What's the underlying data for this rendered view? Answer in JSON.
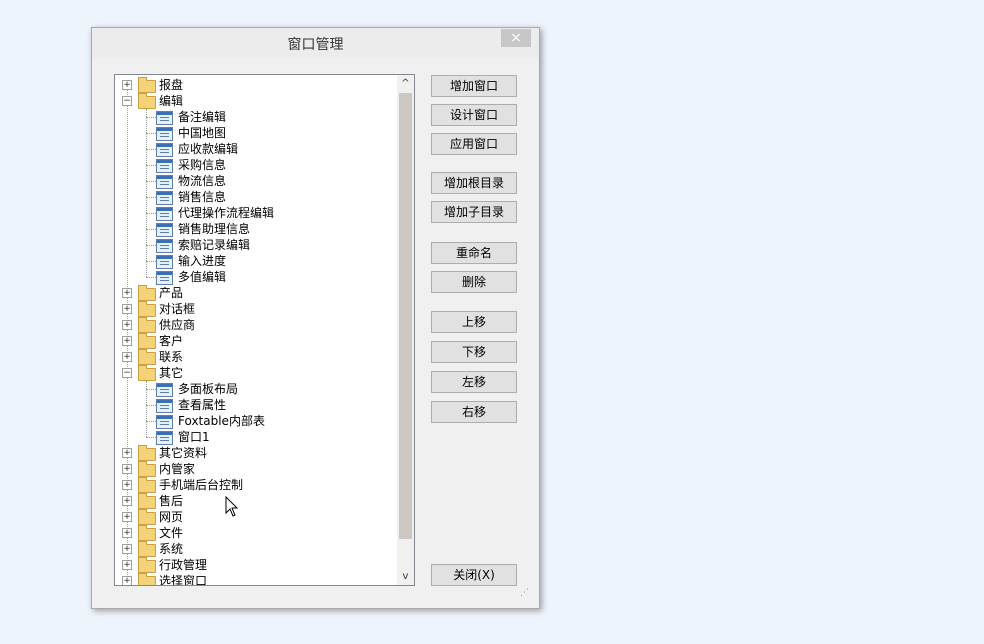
{
  "dialog": {
    "title": "窗口管理",
    "close_glyph": "×"
  },
  "tree": {
    "scroll_up": "^",
    "scroll_down": "v",
    "items": [
      {
        "label": "报盘",
        "level": 0,
        "type": "folder",
        "expanded": false
      },
      {
        "label": "编辑",
        "level": 0,
        "type": "folder",
        "expanded": true
      },
      {
        "label": "备注编辑",
        "level": 1,
        "type": "window"
      },
      {
        "label": "中国地图",
        "level": 1,
        "type": "window"
      },
      {
        "label": "应收款编辑",
        "level": 1,
        "type": "window"
      },
      {
        "label": "采购信息",
        "level": 1,
        "type": "window"
      },
      {
        "label": "物流信息",
        "level": 1,
        "type": "window"
      },
      {
        "label": "销售信息",
        "level": 1,
        "type": "window"
      },
      {
        "label": "代理操作流程编辑",
        "level": 1,
        "type": "window"
      },
      {
        "label": "销售助理信息",
        "level": 1,
        "type": "window"
      },
      {
        "label": "索赔记录编辑",
        "level": 1,
        "type": "window"
      },
      {
        "label": "输入进度",
        "level": 1,
        "type": "window"
      },
      {
        "label": "多值编辑",
        "level": 1,
        "type": "window"
      },
      {
        "label": "产品",
        "level": 0,
        "type": "folder",
        "expanded": false
      },
      {
        "label": "对话框",
        "level": 0,
        "type": "folder",
        "expanded": false
      },
      {
        "label": "供应商",
        "level": 0,
        "type": "folder",
        "expanded": false
      },
      {
        "label": "客户",
        "level": 0,
        "type": "folder",
        "expanded": false
      },
      {
        "label": "联系",
        "level": 0,
        "type": "folder",
        "expanded": false
      },
      {
        "label": "其它",
        "level": 0,
        "type": "folder",
        "expanded": true
      },
      {
        "label": "多面板布局",
        "level": 1,
        "type": "window"
      },
      {
        "label": "查看属性",
        "level": 1,
        "type": "window"
      },
      {
        "label": "Foxtable内部表",
        "level": 1,
        "type": "window"
      },
      {
        "label": "窗口1",
        "level": 1,
        "type": "window"
      },
      {
        "label": "其它资料",
        "level": 0,
        "type": "folder",
        "expanded": false
      },
      {
        "label": "内管家",
        "level": 0,
        "type": "folder",
        "expanded": false
      },
      {
        "label": "手机端后台控制",
        "level": 0,
        "type": "folder",
        "expanded": false
      },
      {
        "label": "售后",
        "level": 0,
        "type": "folder",
        "expanded": false
      },
      {
        "label": "网页",
        "level": 0,
        "type": "folder",
        "expanded": false
      },
      {
        "label": "文件",
        "level": 0,
        "type": "folder",
        "expanded": false
      },
      {
        "label": "系统",
        "level": 0,
        "type": "folder",
        "expanded": false
      },
      {
        "label": "行政管理",
        "level": 0,
        "type": "folder",
        "expanded": false
      },
      {
        "label": "选择窗口",
        "level": 0,
        "type": "folder",
        "expanded": false
      }
    ]
  },
  "buttons": {
    "add_window": "增加窗口",
    "design_window": "设计窗口",
    "apply_window": "应用窗口",
    "add_root_dir": "增加根目录",
    "add_sub_dir": "增加子目录",
    "rename": "重命名",
    "delete": "删除",
    "move_up": "上移",
    "move_down": "下移",
    "move_left": "左移",
    "move_right": "右移",
    "close": "关闭(X)"
  }
}
